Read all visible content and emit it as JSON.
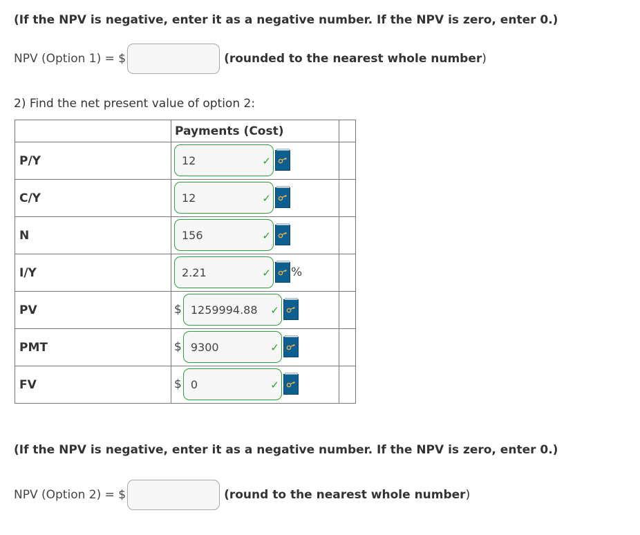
{
  "top": {
    "note": "(If the NPV is negative, enter it as a negative number. If the NPV is zero, enter 0.)",
    "npv_label": "NPV (Option 1) = $",
    "npv_value": "",
    "hint_bold": "(rounded to the nearest whole number",
    "hint_end": ")"
  },
  "question": "2) Find the net present value of option 2:",
  "table": {
    "header": "Payments (Cost)",
    "rows": [
      {
        "label": "P/Y",
        "value": "12"
      },
      {
        "label": "C/Y",
        "value": "12"
      },
      {
        "label": "N",
        "value": "156"
      },
      {
        "label": "I/Y",
        "value": "2.21",
        "suffix": "%"
      },
      {
        "label": "PV",
        "prefix": "$",
        "value": "1259994.88"
      },
      {
        "label": "PMT",
        "prefix": "$",
        "value": "9300"
      },
      {
        "label": "FV",
        "prefix": "$",
        "value": "0"
      }
    ]
  },
  "bottom": {
    "note": "(If the NPV is negative, enter it as a negative number. If the NPV is zero, enter 0.)",
    "npv_label": "NPV (Option 2) = $",
    "npv_value": "",
    "hint_bold": "(round to the nearest whole number",
    "hint_end": ")"
  },
  "colors": {
    "correct_border": "#2e9e3c",
    "key_icon_bg": "#0d5f8f"
  },
  "icons": {
    "check": "check-icon",
    "key": "key-icon"
  }
}
